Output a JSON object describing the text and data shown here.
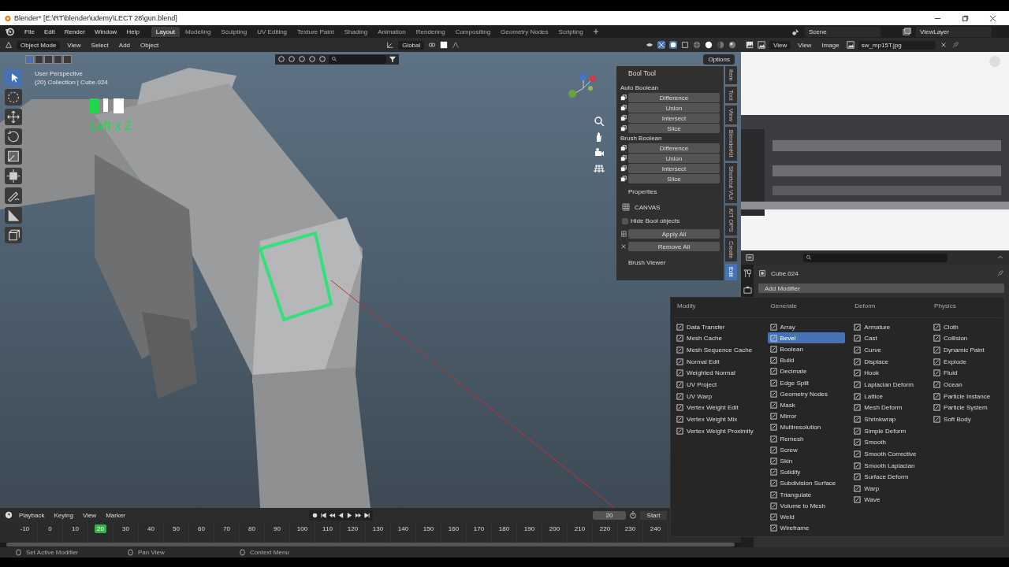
{
  "window": {
    "title": "Blender* [E:\\RT\\blender\\udemy\\LECT 28\\gun.blend]"
  },
  "menu": [
    "File",
    "Edit",
    "Render",
    "Window",
    "Help"
  ],
  "workspaces": [
    {
      "label": "Layout",
      "selected": true
    },
    {
      "label": "Modeling",
      "selected": false
    },
    {
      "label": "Sculpting",
      "selected": false
    },
    {
      "label": "UV Editing",
      "selected": false
    },
    {
      "label": "Texture Paint",
      "selected": false
    },
    {
      "label": "Shading",
      "selected": false
    },
    {
      "label": "Animation",
      "selected": false
    },
    {
      "label": "Rendering",
      "selected": false
    },
    {
      "label": "Compositing",
      "selected": false
    },
    {
      "label": "Geometry Nodes",
      "selected": false
    },
    {
      "label": "Scripting",
      "selected": false
    }
  ],
  "scene": "Scene",
  "view_layer": "ViewLayer",
  "viewport_header": {
    "mode": "Object Mode",
    "menus": [
      "View",
      "Select",
      "Add",
      "Object"
    ],
    "orientation": "Global",
    "options": "Options",
    "shading": [
      {
        "kind": "wireframe",
        "selected": false
      },
      {
        "kind": "solid",
        "selected": true
      },
      {
        "kind": "material",
        "selected": false
      },
      {
        "kind": "rendered",
        "selected": false
      }
    ]
  },
  "toolbar": [
    {
      "kind": "select",
      "selected": true
    },
    {
      "kind": "cursor",
      "selected": false
    },
    {
      "kind": "move",
      "selected": false
    },
    {
      "kind": "rotate",
      "selected": false
    },
    {
      "kind": "scale",
      "selected": false
    },
    {
      "kind": "transform",
      "selected": false
    },
    {
      "kind": "annotate",
      "selected": false
    },
    {
      "kind": "measure",
      "selected": false
    },
    {
      "kind": "add-cube",
      "selected": false
    }
  ],
  "viewport": {
    "perspective": "User Perspective",
    "info": "(20) Collection | Cube.024",
    "keys": "Left x 2"
  },
  "bool_tool": {
    "title": "Bool Tool",
    "sections": [
      {
        "title": "Auto Boolean",
        "buttons": [
          "Difference",
          "Union",
          "Intersect",
          "Slice"
        ]
      },
      {
        "title": "Brush Boolean",
        "buttons": [
          "Difference",
          "Union",
          "Intersect",
          "Slice"
        ]
      }
    ],
    "properties": "Properties",
    "canvas": "CANVAS",
    "hide_bool": {
      "label": "Hide Bool objects",
      "checked": false
    },
    "actions": [
      "Apply All",
      "Remove All"
    ],
    "brush_viewer": "Brush Viewer"
  },
  "sidebar_tabs": [
    {
      "label": "Item",
      "selected": false
    },
    {
      "label": "Tool",
      "selected": false
    },
    {
      "label": "View",
      "selected": false
    },
    {
      "label": "BlenderKit",
      "selected": false
    },
    {
      "label": "Shortcut VUr",
      "selected": false
    },
    {
      "label": "KIT OPS",
      "selected": false
    },
    {
      "label": "Create",
      "selected": false
    },
    {
      "label": "Edit",
      "selected": true
    }
  ],
  "image_header": {
    "view_dropdown": "View",
    "menus": [
      "View",
      "Image"
    ],
    "image": "sw_mp15T.jpg"
  },
  "properties": {
    "object": "Cube.024",
    "add_modifier": "Add Modifier"
  },
  "modifier_menu": {
    "columns": [
      {
        "title": "Modify",
        "items": [
          {
            "label": "Data Transfer",
            "selected": false
          },
          {
            "label": "Mesh Cache",
            "selected": false
          },
          {
            "label": "Mesh Sequence Cache",
            "selected": false
          },
          {
            "label": "Normal Edit",
            "selected": false
          },
          {
            "label": "Weighted Normal",
            "selected": false
          },
          {
            "label": "UV Project",
            "selected": false
          },
          {
            "label": "UV Warp",
            "selected": false
          },
          {
            "label": "Vertex Weight Edit",
            "selected": false
          },
          {
            "label": "Vertex Weight Mix",
            "selected": false
          },
          {
            "label": "Vertex Weight Proximity",
            "selected": false
          }
        ]
      },
      {
        "title": "Generate",
        "items": [
          {
            "label": "Array",
            "selected": false
          },
          {
            "label": "Bevel",
            "selected": true
          },
          {
            "label": "Boolean",
            "selected": false
          },
          {
            "label": "Build",
            "selected": false
          },
          {
            "label": "Decimate",
            "selected": false
          },
          {
            "label": "Edge Split",
            "selected": false
          },
          {
            "label": "Geometry Nodes",
            "selected": false
          },
          {
            "label": "Mask",
            "selected": false
          },
          {
            "label": "Mirror",
            "selected": false
          },
          {
            "label": "Multiresolution",
            "selected": false
          },
          {
            "label": "Remesh",
            "selected": false
          },
          {
            "label": "Screw",
            "selected": false
          },
          {
            "label": "Skin",
            "selected": false
          },
          {
            "label": "Solidify",
            "selected": false
          },
          {
            "label": "Subdivision Surface",
            "selected": false
          },
          {
            "label": "Triangulate",
            "selected": false
          },
          {
            "label": "Volume to Mesh",
            "selected": false
          },
          {
            "label": "Weld",
            "selected": false
          },
          {
            "label": "Wireframe",
            "selected": false
          }
        ]
      },
      {
        "title": "Deform",
        "items": [
          {
            "label": "Armature",
            "selected": false
          },
          {
            "label": "Cast",
            "selected": false
          },
          {
            "label": "Curve",
            "selected": false
          },
          {
            "label": "Displace",
            "selected": false
          },
          {
            "label": "Hook",
            "selected": false
          },
          {
            "label": "Laplacian Deform",
            "selected": false
          },
          {
            "label": "Lattice",
            "selected": false
          },
          {
            "label": "Mesh Deform",
            "selected": false
          },
          {
            "label": "Shrinkwrap",
            "selected": false
          },
          {
            "label": "Simple Deform",
            "selected": false
          },
          {
            "label": "Smooth",
            "selected": false
          },
          {
            "label": "Smooth Corrective",
            "selected": false
          },
          {
            "label": "Smooth Laplacian",
            "selected": false
          },
          {
            "label": "Surface Deform",
            "selected": false
          },
          {
            "label": "Warp",
            "selected": false
          },
          {
            "label": "Wave",
            "selected": false
          }
        ]
      },
      {
        "title": "Physics",
        "items": [
          {
            "label": "Cloth",
            "selected": false
          },
          {
            "label": "Collision",
            "selected": false
          },
          {
            "label": "Dynamic Paint",
            "selected": false
          },
          {
            "label": "Explode",
            "selected": false
          },
          {
            "label": "Fluid",
            "selected": false
          },
          {
            "label": "Ocean",
            "selected": false
          },
          {
            "label": "Particle Instance",
            "selected": false
          },
          {
            "label": "Particle System",
            "selected": false
          },
          {
            "label": "Soft Body",
            "selected": false
          }
        ]
      }
    ]
  },
  "timeline": {
    "menus": [
      "Playback",
      "Keying",
      "View",
      "Marker"
    ],
    "frame": "20",
    "start": "Start",
    "ticks": [
      {
        "label": "-10",
        "selected": false
      },
      {
        "label": "0",
        "selected": false
      },
      {
        "label": "10",
        "selected": false
      },
      {
        "label": "20",
        "selected": true
      },
      {
        "label": "30",
        "selected": false
      },
      {
        "label": "40",
        "selected": false
      },
      {
        "label": "50",
        "selected": false
      },
      {
        "label": "60",
        "selected": false
      },
      {
        "label": "70",
        "selected": false
      },
      {
        "label": "80",
        "selected": false
      },
      {
        "label": "90",
        "selected": false
      },
      {
        "label": "100",
        "selected": false
      },
      {
        "label": "110",
        "selected": false
      },
      {
        "label": "120",
        "selected": false
      },
      {
        "label": "130",
        "selected": false
      },
      {
        "label": "140",
        "selected": false
      },
      {
        "label": "150",
        "selected": false
      },
      {
        "label": "160",
        "selected": false
      },
      {
        "label": "170",
        "selected": false
      },
      {
        "label": "180",
        "selected": false
      },
      {
        "label": "190",
        "selected": false
      },
      {
        "label": "200",
        "selected": false
      },
      {
        "label": "210",
        "selected": false
      },
      {
        "label": "220",
        "selected": false
      },
      {
        "label": "230",
        "selected": false
      },
      {
        "label": "240",
        "selected": false
      }
    ]
  },
  "status_bar": [
    "Set Active Modifier",
    "Pan View",
    "Context Menu"
  ]
}
